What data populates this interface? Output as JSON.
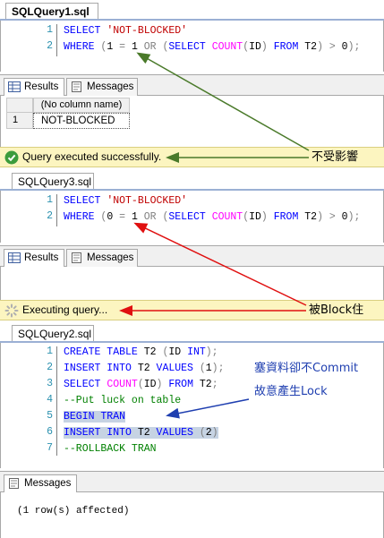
{
  "query1": {
    "tab_title": "SQLQuery1.sql -",
    "lines": [
      {
        "num": "1",
        "parts": [
          [
            "kw",
            "SELECT "
          ],
          [
            "str",
            "'NOT-BLOCKED'"
          ]
        ]
      },
      {
        "num": "2",
        "parts": [
          [
            "kw",
            "WHERE "
          ],
          [
            "op",
            "("
          ],
          [
            "txt",
            "1 "
          ],
          [
            "op",
            "= "
          ],
          [
            "txt",
            "1 "
          ],
          [
            "op",
            "OR ("
          ],
          [
            "kw",
            "SELECT "
          ],
          [
            "fn",
            "COUNT"
          ],
          [
            "op",
            "("
          ],
          [
            "txt",
            "ID"
          ],
          [
            "op",
            ") "
          ],
          [
            "kw",
            "FROM "
          ],
          [
            "txt",
            "T2"
          ],
          [
            "op",
            ") > "
          ],
          [
            "txt",
            "0"
          ],
          [
            "op",
            ");"
          ]
        ]
      }
    ],
    "results_tab": "Results",
    "messages_tab": "Messages",
    "grid_header": "(No column name)",
    "grid_row_num": "1",
    "grid_value": "NOT-BLOCKED",
    "status_text": "Query executed successfully.",
    "annotation": "不受影響"
  },
  "query3": {
    "tab_title": "SQLQuery3.sql",
    "lines": [
      {
        "num": "1",
        "parts": [
          [
            "kw",
            "SELECT "
          ],
          [
            "str",
            "'NOT-BLOCKED'"
          ]
        ]
      },
      {
        "num": "2",
        "parts": [
          [
            "kw",
            "WHERE "
          ],
          [
            "op",
            "("
          ],
          [
            "txt",
            "0 "
          ],
          [
            "op",
            "= "
          ],
          [
            "txt",
            "1 "
          ],
          [
            "op",
            "OR ("
          ],
          [
            "kw",
            "SELECT "
          ],
          [
            "fn",
            "COUNT"
          ],
          [
            "op",
            "("
          ],
          [
            "txt",
            "ID"
          ],
          [
            "op",
            ") "
          ],
          [
            "kw",
            "FROM "
          ],
          [
            "txt",
            "T2"
          ],
          [
            "op",
            ") > "
          ],
          [
            "txt",
            "0"
          ],
          [
            "op",
            ");"
          ]
        ]
      }
    ],
    "results_tab": "Results",
    "messages_tab": "Messages",
    "status_text": "Executing query...",
    "annotation": "被Block住"
  },
  "query2": {
    "tab_title": "SQLQuery2.sql",
    "lines": [
      {
        "num": "1",
        "parts": [
          [
            "kw",
            "CREATE TABLE "
          ],
          [
            "txt",
            "T2 "
          ],
          [
            "op",
            "("
          ],
          [
            "txt",
            "ID "
          ],
          [
            "kw",
            "INT"
          ],
          [
            "op",
            ");"
          ]
        ]
      },
      {
        "num": "2",
        "parts": [
          [
            "kw",
            "INSERT INTO "
          ],
          [
            "txt",
            "T2 "
          ],
          [
            "kw",
            "VALUES "
          ],
          [
            "op",
            "("
          ],
          [
            "txt",
            "1"
          ],
          [
            "op",
            ");"
          ]
        ]
      },
      {
        "num": "3",
        "parts": [
          [
            "kw",
            "SELECT "
          ],
          [
            "fn",
            "COUNT"
          ],
          [
            "op",
            "("
          ],
          [
            "txt",
            "ID"
          ],
          [
            "op",
            ") "
          ],
          [
            "kw",
            "FROM "
          ],
          [
            "txt",
            "T2"
          ],
          [
            "op",
            ";"
          ]
        ]
      },
      {
        "num": "4",
        "parts": [
          [
            "cm",
            "--Put luck on table"
          ]
        ]
      },
      {
        "num": "5",
        "parts": [
          [
            "kw",
            "BEGIN TRAN"
          ]
        ]
      },
      {
        "num": "6",
        "parts": [
          [
            "kw",
            "INSERT INTO "
          ],
          [
            "txt",
            "T2 "
          ],
          [
            "kw",
            "VALUES "
          ],
          [
            "op",
            "("
          ],
          [
            "txt",
            "2"
          ],
          [
            "op",
            ")"
          ]
        ]
      },
      {
        "num": "7",
        "parts": [
          [
            "cm",
            "--ROLLBACK TRAN"
          ]
        ]
      }
    ],
    "messages_tab": "Messages",
    "message_text": "(1 row(s) affected)",
    "annotation_line1": "塞資料卻不Commit",
    "annotation_line2": "故意產生Lock"
  },
  "colors": {
    "green_arrow": "#4a7a2a",
    "red_arrow": "#e01010",
    "blue_arrow": "#1f3fb0",
    "status_bg": "#fcf5c0"
  }
}
